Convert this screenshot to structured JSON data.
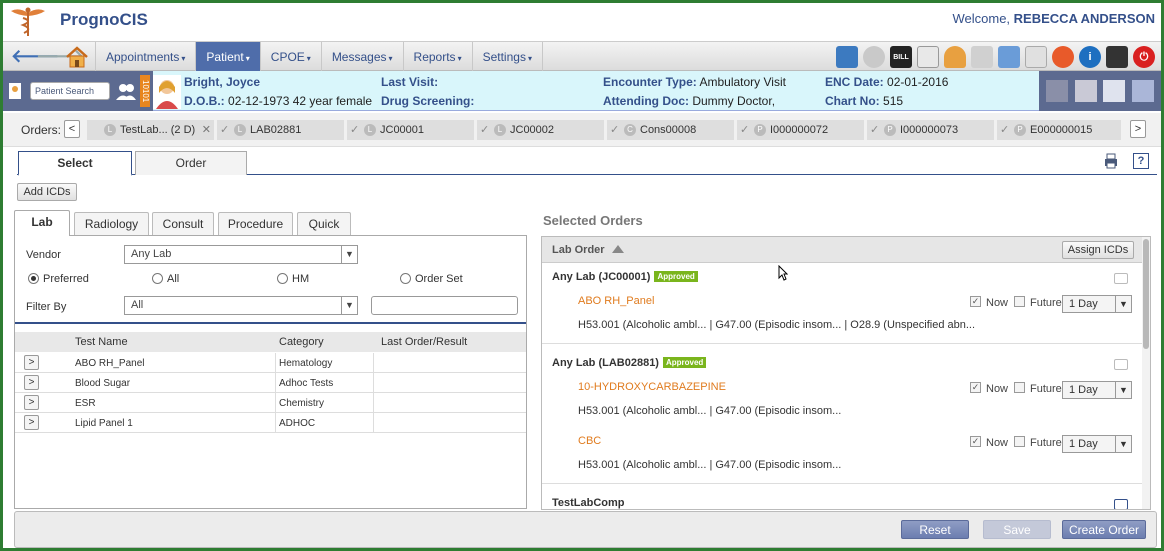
{
  "app": {
    "title": "PrognoCIS",
    "welcome_prefix": "Welcome,",
    "user_name": "REBECCA ANDERSON"
  },
  "nav": {
    "menu": [
      {
        "label": "Appointments",
        "active": false
      },
      {
        "label": "Patient",
        "active": true
      },
      {
        "label": "CPOE",
        "active": false
      },
      {
        "label": "Messages",
        "active": false
      },
      {
        "label": "Reports",
        "active": false
      },
      {
        "label": "Settings",
        "active": false
      }
    ],
    "caret": "▾",
    "bill_icon_text": "BILL"
  },
  "patient": {
    "search_placeholder": "Patient Search",
    "vertical_tab": "10101",
    "name": "Bright, Joyce",
    "dob_label": "D.O.B.:",
    "dob_value": "02-12-1973 42 year female",
    "last_visit_label": "Last Visit:",
    "drug_screening_label": "Drug Screening:",
    "encounter_type_label": "Encounter Type:",
    "encounter_type_value": "Ambulatory Visit",
    "attending_doc_label": "Attending Doc:",
    "attending_doc_value": "Dummy Doctor,",
    "enc_date_label": "ENC Date:",
    "enc_date_value": "02-01-2016",
    "chart_no_label": "Chart No:",
    "chart_no_value": "515"
  },
  "orders_strip": {
    "label": "Orders:",
    "prev": "<",
    "next": ">",
    "chips": [
      {
        "status": "L",
        "label": "TestLab... (2 D)",
        "closable": true,
        "checked": false
      },
      {
        "status": "L",
        "label": "LAB02881",
        "closable": false,
        "checked": true
      },
      {
        "status": "L",
        "label": "JC00001",
        "closable": false,
        "checked": true
      },
      {
        "status": "L",
        "label": "JC00002",
        "closable": false,
        "checked": true
      },
      {
        "status": "C",
        "label": "Cons00008",
        "closable": false,
        "checked": true
      },
      {
        "status": "P",
        "label": "I000000072",
        "closable": false,
        "checked": true
      },
      {
        "status": "P",
        "label": "I000000073",
        "closable": false,
        "checked": true
      },
      {
        "status": "P",
        "label": "E000000015",
        "closable": false,
        "checked": true
      }
    ]
  },
  "main_tabs": {
    "select": "Select",
    "order": "Order",
    "help": "?"
  },
  "add_icds": "Add ICDs",
  "left": {
    "tabs": [
      "Lab",
      "Radiology",
      "Consult",
      "Procedure",
      "Quick"
    ],
    "vendor_label": "Vendor",
    "vendor_value": "Any Lab",
    "radios": [
      {
        "label": "Preferred",
        "on": true
      },
      {
        "label": "All",
        "on": false
      },
      {
        "label": "HM",
        "on": false
      },
      {
        "label": "Order Set",
        "on": false
      }
    ],
    "filter_label": "Filter By",
    "filter_value": "All",
    "filter_text": "",
    "columns": [
      "Test Name",
      "Category",
      "Last Order/Result"
    ],
    "rows": [
      {
        "test": "ABO RH_Panel",
        "category": "Hematology",
        "last": ""
      },
      {
        "test": "Blood Sugar",
        "category": "Adhoc Tests",
        "last": ""
      },
      {
        "test": "ESR",
        "category": "Chemistry",
        "last": ""
      },
      {
        "test": "Lipid Panel 1",
        "category": "ADHOC",
        "last": ""
      }
    ]
  },
  "right": {
    "title": "Selected Orders",
    "header": "Lab Order",
    "assign_icds": "Assign ICDs",
    "now_label": "Now",
    "future_label": "Future",
    "groups": [
      {
        "title": "Any Lab  (JC00001)",
        "badge": "Approved",
        "tests": [
          {
            "name": "ABO RH_Panel",
            "icds": "H53.001 (Alcoholic ambl...   | G47.00 (Episodic insom...   | O28.9 (Unspecified abn...",
            "now": true,
            "future": false,
            "period": "1 Day"
          }
        ]
      },
      {
        "title": "Any Lab  (LAB02881)",
        "badge": "Approved",
        "tests": [
          {
            "name": "10-HYDROXYCARBAZEPINE",
            "icds": "H53.001 (Alcoholic ambl...   | G47.00 (Episodic insom...",
            "now": true,
            "future": false,
            "period": "1 Day"
          },
          {
            "name": "CBC",
            "icds": "H53.001 (Alcoholic ambl...   | G47.00 (Episodic insom...",
            "now": true,
            "future": false,
            "period": "1 Day"
          }
        ]
      },
      {
        "title": "TestLabComp",
        "badge": "",
        "tests": []
      }
    ]
  },
  "footer": {
    "reset": "Reset",
    "save": "Save",
    "create_order": "Create Order"
  }
}
